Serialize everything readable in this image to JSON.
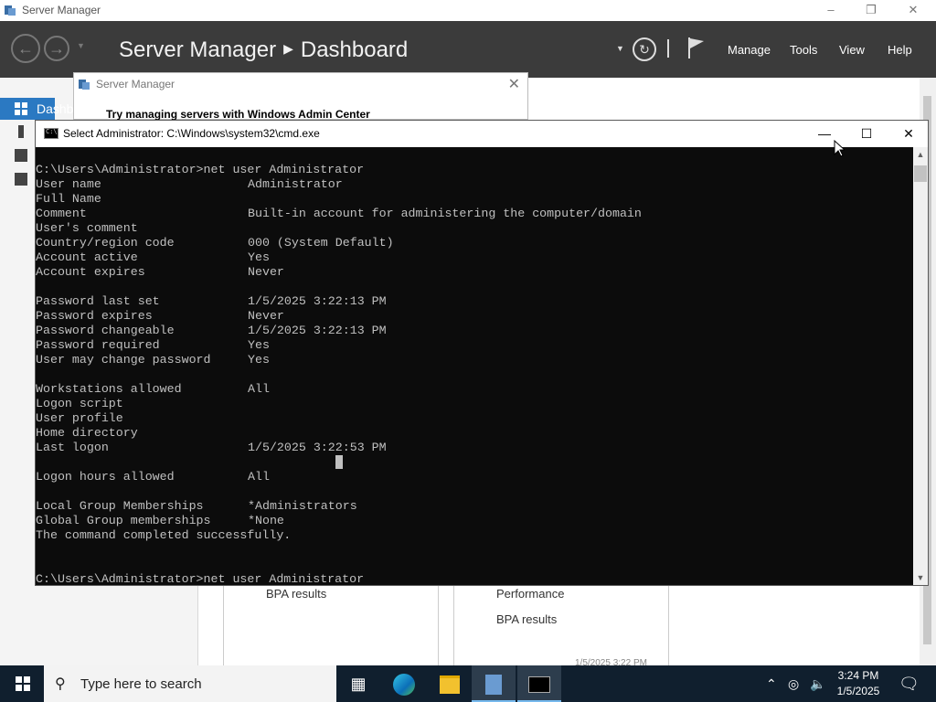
{
  "server_manager": {
    "window_title": "Server Manager",
    "breadcrumb_app": "Server Manager",
    "breadcrumb_page": "Dashboard",
    "menu": [
      "Manage",
      "Tools",
      "View",
      "Help"
    ],
    "sidebar_selected": "Dashb",
    "tiles": {
      "left_bpa": "BPA results",
      "right_performance": "Performance",
      "right_bpa": "BPA results",
      "right_timestamp": "1/5/2025 3:22 PM"
    },
    "popup": {
      "title": "Server Manager",
      "text": "Try managing servers with Windows Admin Center"
    }
  },
  "cmd": {
    "title": "Select Administrator: C:\\Windows\\system32\\cmd.exe",
    "lines": [
      {
        "a": "C:\\Users\\Administrator>net user Administrator",
        "b": ""
      },
      {
        "a": "User name",
        "b": "Administrator"
      },
      {
        "a": "Full Name",
        "b": ""
      },
      {
        "a": "Comment",
        "b": "Built-in account for administering the computer/domain"
      },
      {
        "a": "User's comment",
        "b": ""
      },
      {
        "a": "Country/region code",
        "b": "000 (System Default)"
      },
      {
        "a": "Account active",
        "b": "Yes"
      },
      {
        "a": "Account expires",
        "b": "Never"
      },
      {
        "a": "",
        "b": ""
      },
      {
        "a": "Password last set",
        "b": "1/5/2025 3:22:13 PM"
      },
      {
        "a": "Password expires",
        "b": "Never"
      },
      {
        "a": "Password changeable",
        "b": "1/5/2025 3:22:13 PM"
      },
      {
        "a": "Password required",
        "b": "Yes"
      },
      {
        "a": "User may change password",
        "b": "Yes"
      },
      {
        "a": "",
        "b": ""
      },
      {
        "a": "Workstations allowed",
        "b": "All"
      },
      {
        "a": "Logon script",
        "b": ""
      },
      {
        "a": "User profile",
        "b": ""
      },
      {
        "a": "Home directory",
        "b": ""
      },
      {
        "a": "Last logon",
        "b": "1/5/2025 3:22:53 PM"
      },
      {
        "a": "",
        "b": ""
      },
      {
        "a": "Logon hours allowed",
        "b": "All"
      },
      {
        "a": "",
        "b": ""
      },
      {
        "a": "Local Group Memberships",
        "b": "*Administrators"
      },
      {
        "a": "Global Group memberships",
        "b": "*None"
      },
      {
        "a": "The command completed successfully.",
        "b": ""
      },
      {
        "a": "",
        "b": ""
      },
      {
        "a": "",
        "b": ""
      },
      {
        "a": "C:\\Users\\Administrator>net user Administrator",
        "b": ""
      }
    ]
  },
  "taskbar": {
    "search_placeholder": "Type here to search",
    "time": "3:24 PM",
    "date": "1/5/2025"
  },
  "colors": {
    "sm_header": "#3b3b3b",
    "sm_accent": "#2b79c2",
    "console_bg": "#0c0c0c",
    "console_fg": "#c0c0c0",
    "taskbar": "#101f2e"
  }
}
